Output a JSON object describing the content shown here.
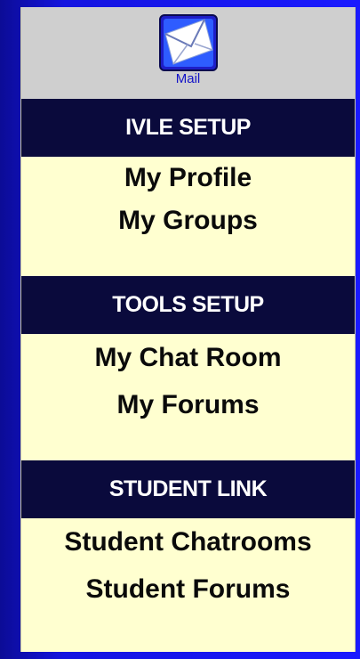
{
  "mail": {
    "label": "Mail",
    "icon": "mail-envelope-icon"
  },
  "sections": [
    {
      "header": "IVLE SETUP",
      "items": [
        "My Profile",
        "My Groups"
      ]
    },
    {
      "header": "TOOLS SETUP",
      "items": [
        "My Chat Room",
        "My Forums"
      ]
    },
    {
      "header": "STUDENT LINK",
      "items": [
        "Student Chatrooms",
        "Student Forums"
      ]
    }
  ],
  "colors": {
    "background": "#1a1aff",
    "panel": "#ffffd0",
    "header": "#0a0a3c",
    "header_text": "#ffffff",
    "item_text": "#0a0a0a",
    "mail_bar": "#cfcfcf",
    "mail_label": "#1212c8"
  }
}
